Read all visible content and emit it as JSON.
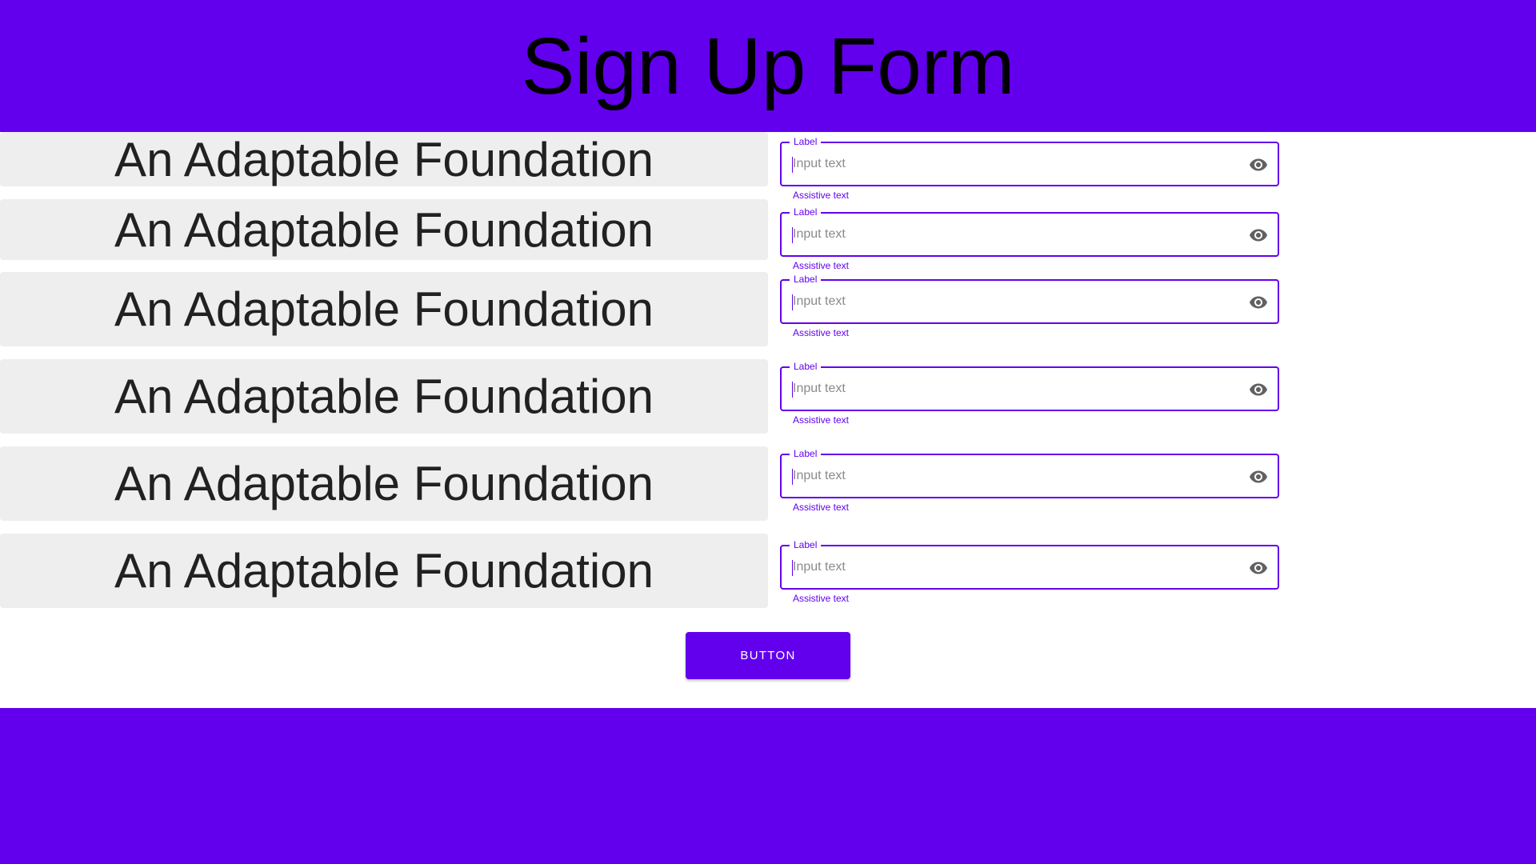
{
  "header": {
    "title": "Sign Up Form",
    "background": "#6200EE"
  },
  "rows": [
    {
      "card_text": "An Adaptable Foundation",
      "field_label": "Label",
      "placeholder": "Input text",
      "value": "",
      "assistive": "Assistive text",
      "icon": "eye-icon"
    },
    {
      "card_text": "An Adaptable Foundation",
      "field_label": "Label",
      "placeholder": "Input text",
      "value": "",
      "assistive": "Assistive text",
      "icon": "eye-icon"
    },
    {
      "card_text": "An Adaptable Foundation",
      "field_label": "Label",
      "placeholder": "Input text",
      "value": "",
      "assistive": "Assistive text",
      "icon": "eye-icon"
    },
    {
      "card_text": "An Adaptable Foundation",
      "field_label": "Label",
      "placeholder": "Input text",
      "value": "",
      "assistive": "Assistive text",
      "icon": "eye-icon"
    },
    {
      "card_text": "An Adaptable Foundation",
      "field_label": "Label",
      "placeholder": "Input text",
      "value": "",
      "assistive": "Assistive text",
      "icon": "eye-icon"
    },
    {
      "card_text": "An Adaptable Foundation",
      "field_label": "Label",
      "placeholder": "Input text",
      "value": "",
      "assistive": "Assistive text",
      "icon": "eye-icon"
    }
  ],
  "button": {
    "label": "BUTTON"
  },
  "colors": {
    "primary": "#6200EE",
    "card": "#EEEEEE",
    "text": "#212121"
  }
}
